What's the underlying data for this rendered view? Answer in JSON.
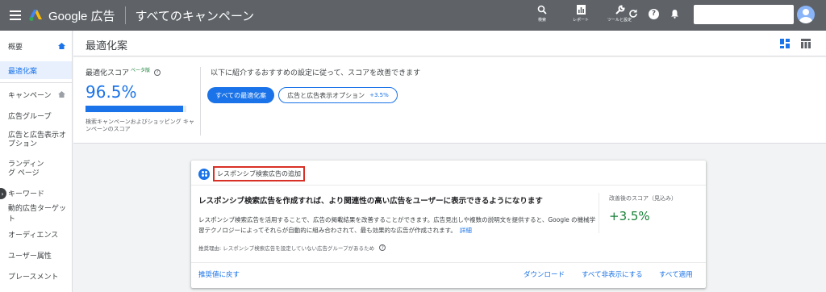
{
  "topbar": {
    "brand": "Google 広告",
    "campaign_scope": "すべてのキャンペーン",
    "tools": [
      {
        "icon": "search-icon",
        "label": "検索"
      },
      {
        "icon": "reports-icon",
        "label": "レポート"
      },
      {
        "icon": "wrench-icon",
        "label": "ツールと設定"
      }
    ],
    "icons": [
      "refresh-icon",
      "help-icon",
      "bell-icon"
    ]
  },
  "sidebar": {
    "items": [
      {
        "label": "概要"
      },
      {
        "label": "最適化案"
      },
      {
        "label": "キャンペーン"
      },
      {
        "label": "広告グループ"
      },
      {
        "label": "広告と広告表示オプション"
      },
      {
        "label": "ランディング ページ"
      },
      {
        "label": "キーワード"
      },
      {
        "label": "動的広告ターゲット"
      },
      {
        "label": "オーディエンス"
      },
      {
        "label": "ユーザー属性"
      },
      {
        "label": "プレースメント"
      }
    ]
  },
  "page": {
    "title": "最適化案"
  },
  "score": {
    "label": "最適化スコア",
    "beta": "ベータ版",
    "value": "96.5%",
    "progress": 0.965,
    "caption": "検索キャンペーンおよびショッピング キャンペーンのスコア"
  },
  "intro": "以下に紹介するおすすめの設定に従って、スコアを改善できます",
  "filters": {
    "all": "すべての最適化案",
    "ads": "広告と広告表示オプション",
    "ads_pct": "+3.5%"
  },
  "card": {
    "tag": "レスポンシブ検索広告の追加",
    "heading": "レスポンシブ検索広告を作成すれば、より関連性の高い広告をユーザーに表示できるようになります",
    "body": "レスポンシブ検索広告を活用することで、広告の掲載結果を改善することができます。広告見出しや複数の説明文を提供すると、Google の機械学習テクノロジーによってそれらが自動的に組み合わされて、最も効果的な広告が作成されます。",
    "link": "詳細",
    "reason": "推奨理由: レスポンシブ検索広告を設定していない広告グループがあるため",
    "est_label": "改善後のスコア（見込み）",
    "est_value": "+3.5%",
    "actions": {
      "revert": "推奨値に戻す",
      "download": "ダウンロード",
      "hide_all": "すべて非表示にする",
      "apply_all": "すべて適用"
    }
  },
  "colors": {
    "topbar": "#5f6368",
    "accent": "#1a73e8",
    "positive": "#188038",
    "highlight_border": "#d93025"
  }
}
